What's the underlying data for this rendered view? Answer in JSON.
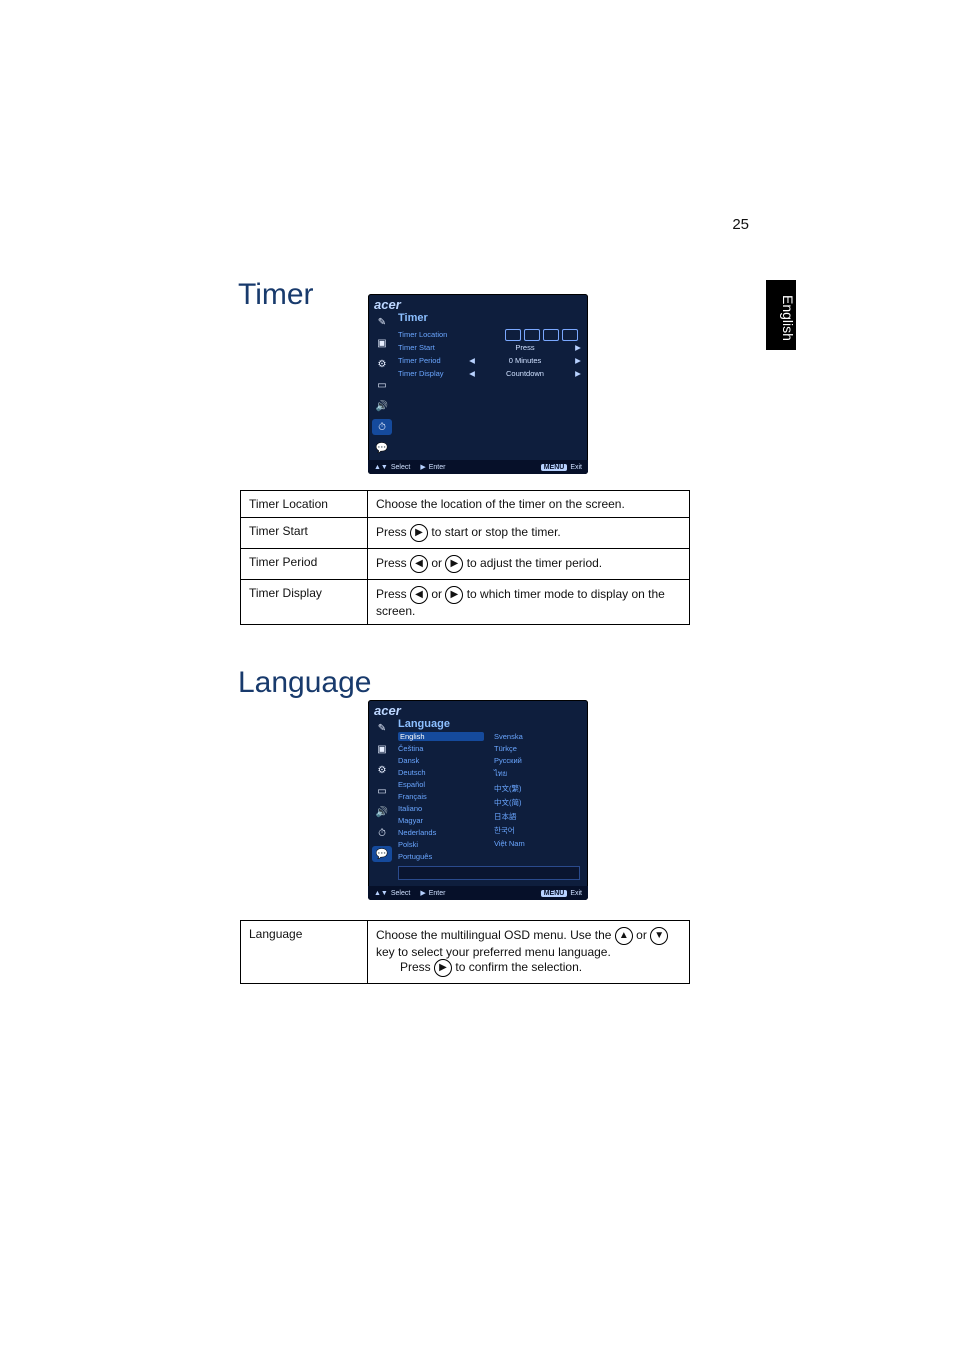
{
  "page": {
    "number": "25",
    "language_tab": "English"
  },
  "sections": {
    "timer": "Timer",
    "language": "Language"
  },
  "osd_brand": "acer",
  "osd_footer": {
    "select": "Select",
    "enter": "Enter",
    "menu_badge": "MENU",
    "exit": "Exit"
  },
  "timer_osd": {
    "title": "Timer",
    "rows": {
      "location": "Timer Location",
      "start": "Timer Start",
      "period": "Timer Period",
      "display": "Timer Display"
    },
    "values": {
      "start": "Press",
      "period": "0  Minutes",
      "display": "Countdown"
    }
  },
  "timer_table": {
    "location": {
      "label": "Timer Location",
      "desc": "Choose the location of the timer on the screen."
    },
    "start": {
      "label": "Timer Start",
      "desc_prefix": "Press ",
      "desc_suffix": " to start or stop the timer."
    },
    "period": {
      "label": "Timer Period",
      "desc_prefix": "Press ",
      "desc_mid": " or ",
      "desc_suffix": " to adjust the timer period."
    },
    "display": {
      "label": "Timer Display",
      "desc_prefix": "Press ",
      "desc_mid": " or ",
      "desc_suffix": " to which timer mode to display on the screen."
    }
  },
  "lang_osd": {
    "title": "Language",
    "col1": [
      "English",
      "Čeština",
      "Dansk",
      "Deutsch",
      "Español",
      "Français",
      "Italiano",
      "Magyar",
      "Nederlands",
      "Polski",
      "Português"
    ],
    "col2": [
      "Svenska",
      "Türkçe",
      "Русский",
      "ไทย",
      "中文(繁)",
      "中文(简)",
      "日本語",
      "한국어",
      "Việt Nam"
    ]
  },
  "lang_table": {
    "label": "Language",
    "line1_a": "Choose the multilingual OSD menu. Use the ",
    "line1_b": " or ",
    "line1_c": " key to select your preferred menu language.",
    "line2_a": "Press ",
    "line2_b": " to confirm the selection."
  }
}
